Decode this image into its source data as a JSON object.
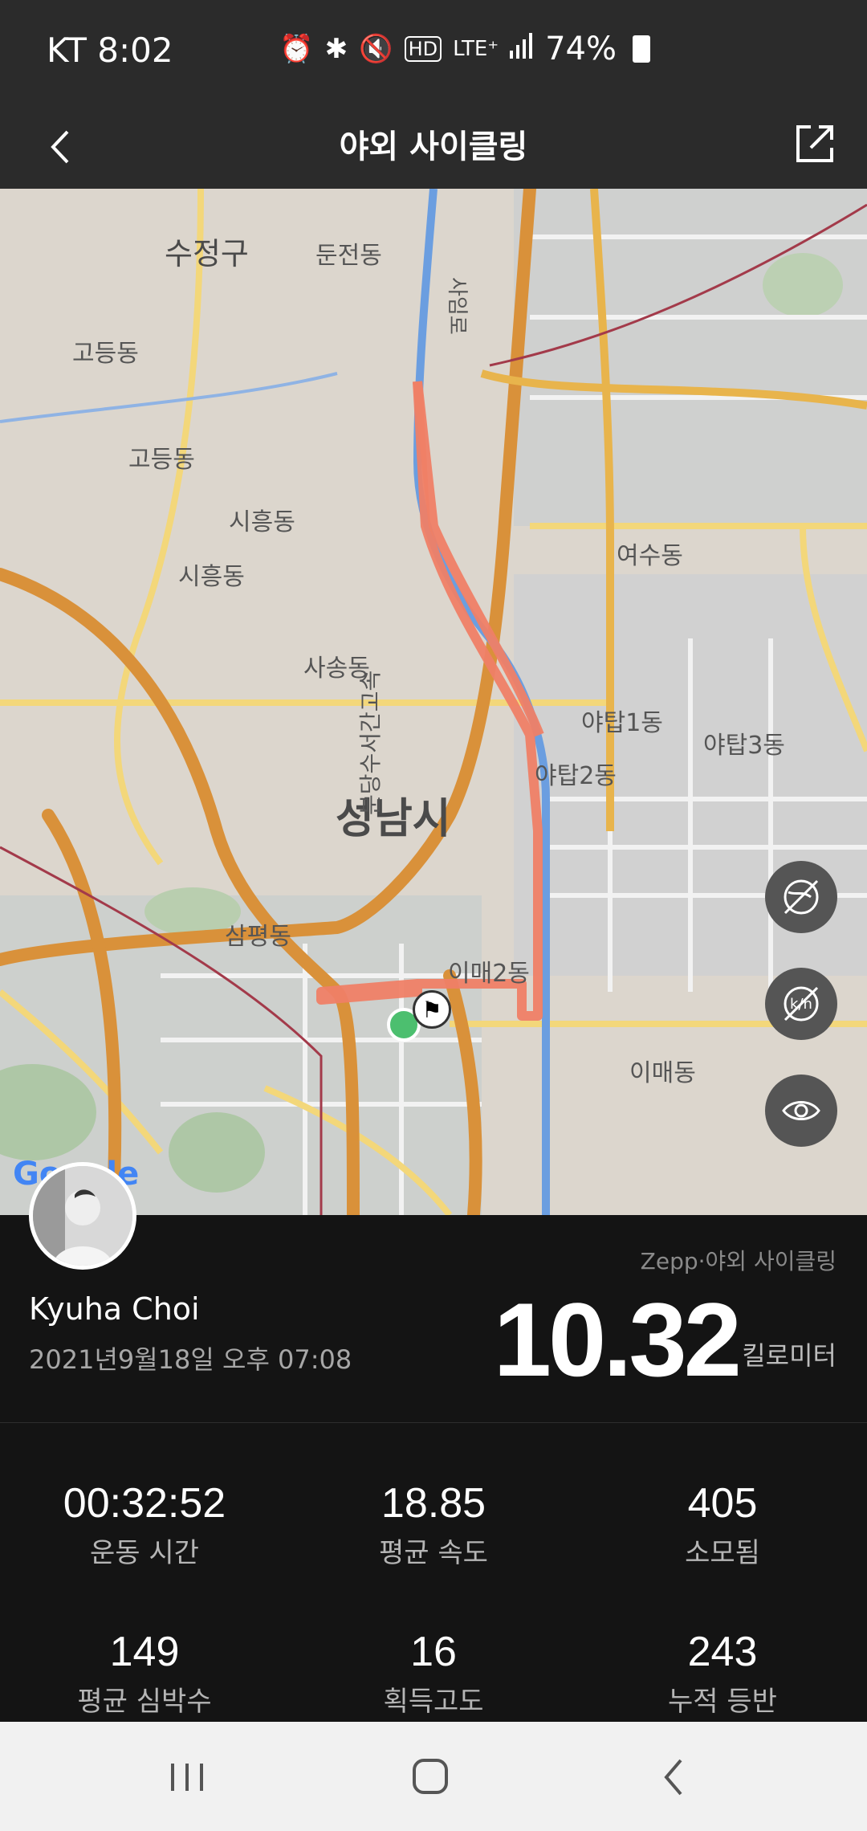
{
  "status_bar": {
    "carrier_time": "KT 8:02",
    "battery_percent": "74%",
    "icons": [
      "alarm-icon",
      "bluetooth-icon",
      "mute-icon",
      "hd-voice-icon",
      "lte-plus-icon",
      "signal-icon",
      "battery-icon"
    ]
  },
  "header": {
    "title": "야외 사이클링",
    "back_icon": "chevron-left-icon",
    "share_icon": "share-icon"
  },
  "map": {
    "labels": [
      {
        "text": "수정구",
        "size": "big-ish"
      },
      {
        "text": "둔전동"
      },
      {
        "text": "고등동"
      },
      {
        "text": "고등동"
      },
      {
        "text": "시흥동"
      },
      {
        "text": "시흥동"
      },
      {
        "text": "사송동"
      },
      {
        "text": "여수동"
      },
      {
        "text": "야탑1동"
      },
      {
        "text": "야탑3동"
      },
      {
        "text": "야탑2동"
      },
      {
        "text": "성남시"
      },
      {
        "text": "삼평동"
      },
      {
        "text": "이매2동"
      },
      {
        "text": "이매동"
      },
      {
        "text": "분당수서간고속"
      },
      {
        "text": "사임로"
      }
    ],
    "watermark": "Google",
    "controls": [
      "no-satellite-icon",
      "no-km-marker-icon",
      "eye-icon"
    ],
    "route_color": "#ef7f66",
    "start_marker_color": "#4cbf6f"
  },
  "summary": {
    "user_name": "Kyuha Choi",
    "date": "2021년9월18일 오후 07:08",
    "source": "Zepp·야외 사이클링",
    "distance": "10.32",
    "distance_unit": "킬로미터"
  },
  "stats": [
    {
      "value": "00:32:52",
      "label": "운동 시간"
    },
    {
      "value": "18.85",
      "label": "평균 속도"
    },
    {
      "value": "405",
      "label": "소모됨"
    },
    {
      "value": "149",
      "label": "평균 심박수"
    },
    {
      "value": "16",
      "label": "획득고도"
    },
    {
      "value": "243",
      "label": "누적 등반"
    }
  ],
  "nav_bar": {
    "icons": [
      "recent-apps-icon",
      "home-icon",
      "back-icon"
    ]
  }
}
